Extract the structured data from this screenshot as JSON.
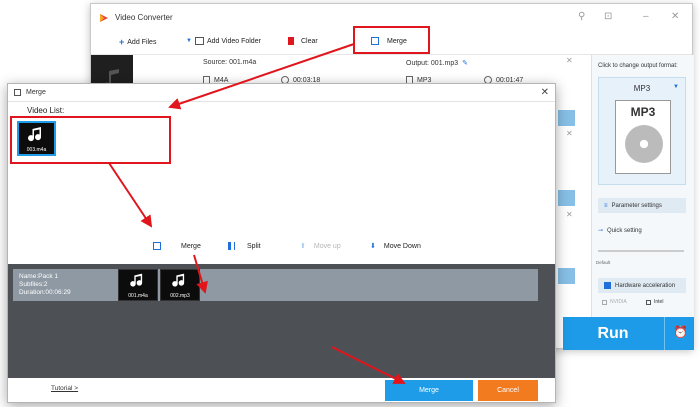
{
  "app": {
    "title": "Video Converter",
    "toolbar": {
      "add_files": "Add Files",
      "add_video_folder": "Add Video Folder",
      "clear": "Clear",
      "merge": "Merge"
    },
    "files": [
      {
        "source": "Source: 001.m4a",
        "format": "M4A",
        "duration": "00:03:18",
        "output": "Output: 001.mp3",
        "out_format": "MP3",
        "out_duration": "00:01:47"
      }
    ],
    "side_panel": {
      "hint": "Click to change output format:",
      "format": "MP3",
      "format_badge": "MP3",
      "parameter_settings": "Parameter settings",
      "quick_setting": "Quick setting",
      "default_label": "Default",
      "hardware_acceleration": "Hardware acceleration",
      "nvidia": "NVIDIA",
      "intel": "Intel"
    },
    "run": "Run"
  },
  "dialog": {
    "title": "Merge",
    "video_list_label": "Video List:",
    "video_list_items": [
      {
        "name": "003.m4a"
      }
    ],
    "controls": {
      "merge": "Merge",
      "split": "Split",
      "move_up": "Move up",
      "move_down": "Move Down"
    },
    "pack": {
      "name": "Name:Pack 1",
      "subfiles": "Subfiles:2",
      "duration": "Duration:00:06:29",
      "items": [
        {
          "name": "001.m4a"
        },
        {
          "name": "002.mp3"
        }
      ]
    },
    "tutorial": "Tutorial >",
    "merge_button": "Merge",
    "cancel_button": "Cancel"
  },
  "colors": {
    "accent_blue": "#1e9ce8",
    "cancel_orange": "#f27a1f",
    "annotation_red": "#e0161c",
    "pack_area": "#4d5156",
    "pack_row": "#8e99a4"
  }
}
